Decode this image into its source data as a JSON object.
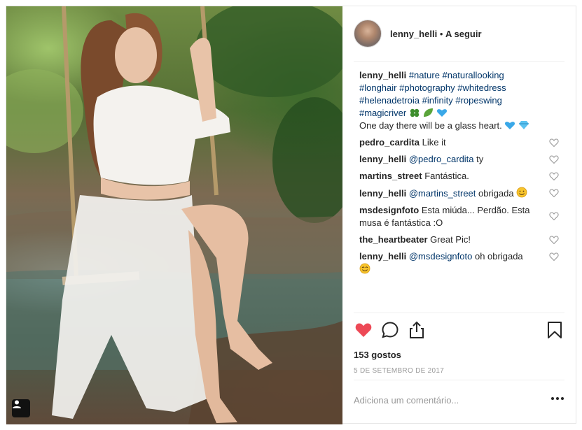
{
  "post": {
    "username": "lenny_helli",
    "separator": "•",
    "follow_label": "A seguir",
    "caption": {
      "user": "lenny_helli",
      "tags": [
        "#nature",
        "#naturallooking",
        "#longhair",
        "#photography",
        "#whitedress",
        "#helenadetroia",
        "#infinity",
        "#ropeswing",
        "#magicriver"
      ],
      "text": "One day there will be a glass heart."
    },
    "comments": [
      {
        "user": "pedro_cardita",
        "mention": "",
        "text": "Like it"
      },
      {
        "user": "lenny_helli",
        "mention": "@pedro_cardita",
        "text": "ty"
      },
      {
        "user": "martins_street",
        "mention": "",
        "text": "Fantástica."
      },
      {
        "user": "lenny_helli",
        "mention": "@martins_street",
        "text": "obrigada"
      },
      {
        "user": "msdesignfoto",
        "mention": "",
        "text": "Esta miúda... Perdão. Esta musa é fantástica :O"
      },
      {
        "user": "the_heartbeater",
        "mention": "",
        "text": "Great Pic!"
      },
      {
        "user": "lenny_helli",
        "mention": "@msdesignfoto",
        "text": "oh obrigada"
      }
    ],
    "likes": "153 gostos",
    "date": "5 DE SETEMBRO DE 2017",
    "comment_placeholder": "Adiciona um comentário...",
    "liked": true,
    "colors": {
      "like_red": "#ed4956",
      "link_blue": "#003569",
      "muted": "#999999"
    }
  },
  "icons": [
    "like-heart-icon",
    "comment-icon",
    "share-icon",
    "bookmark-icon",
    "more-options-icon",
    "tagged-user-icon"
  ]
}
